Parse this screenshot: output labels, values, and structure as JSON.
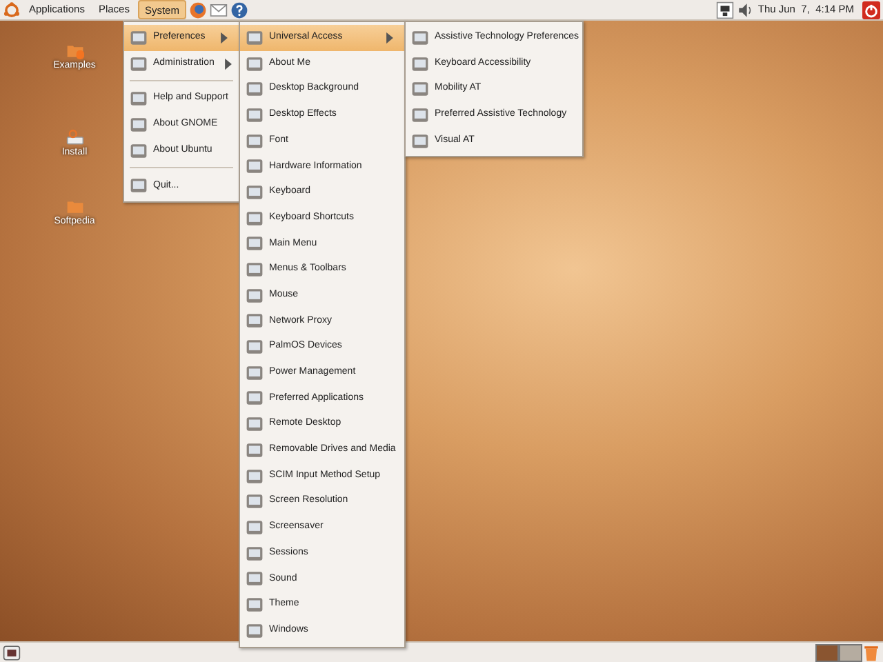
{
  "top_panel": {
    "menus": [
      {
        "label": "Applications",
        "selected": false
      },
      {
        "label": "Places",
        "selected": false
      },
      {
        "label": "System",
        "selected": true
      }
    ],
    "clock": "Thu Jun  7,  4:14 PM"
  },
  "desktop_icons": [
    {
      "label": "Examples"
    },
    {
      "label": "Install"
    },
    {
      "label": "Softpedia"
    }
  ],
  "system_menu": [
    {
      "kind": "item",
      "label": "Preferences",
      "submenu": true,
      "selected": true
    },
    {
      "kind": "item",
      "label": "Administration",
      "submenu": true,
      "selected": false
    },
    {
      "kind": "separator"
    },
    {
      "kind": "item",
      "label": "Help and Support",
      "submenu": false,
      "selected": false
    },
    {
      "kind": "item",
      "label": "About GNOME",
      "submenu": false,
      "selected": false
    },
    {
      "kind": "item",
      "label": "About Ubuntu",
      "submenu": false,
      "selected": false
    },
    {
      "kind": "separator"
    },
    {
      "kind": "item",
      "label": "Quit...",
      "submenu": false,
      "selected": false
    }
  ],
  "preferences_menu": [
    {
      "label": "Universal Access",
      "submenu": true,
      "selected": true
    },
    {
      "label": "About Me",
      "submenu": false,
      "selected": false
    },
    {
      "label": "Desktop Background",
      "submenu": false,
      "selected": false
    },
    {
      "label": "Desktop Effects",
      "submenu": false,
      "selected": false
    },
    {
      "label": "Font",
      "submenu": false,
      "selected": false
    },
    {
      "label": "Hardware Information",
      "submenu": false,
      "selected": false
    },
    {
      "label": "Keyboard",
      "submenu": false,
      "selected": false
    },
    {
      "label": "Keyboard Shortcuts",
      "submenu": false,
      "selected": false
    },
    {
      "label": "Main Menu",
      "submenu": false,
      "selected": false
    },
    {
      "label": "Menus & Toolbars",
      "submenu": false,
      "selected": false
    },
    {
      "label": "Mouse",
      "submenu": false,
      "selected": false
    },
    {
      "label": "Network Proxy",
      "submenu": false,
      "selected": false
    },
    {
      "label": "PalmOS Devices",
      "submenu": false,
      "selected": false
    },
    {
      "label": "Power Management",
      "submenu": false,
      "selected": false
    },
    {
      "label": "Preferred Applications",
      "submenu": false,
      "selected": false
    },
    {
      "label": "Remote Desktop",
      "submenu": false,
      "selected": false
    },
    {
      "label": "Removable Drives and Media",
      "submenu": false,
      "selected": false
    },
    {
      "label": "SCIM Input Method Setup",
      "submenu": false,
      "selected": false
    },
    {
      "label": "Screen Resolution",
      "submenu": false,
      "selected": false
    },
    {
      "label": "Screensaver",
      "submenu": false,
      "selected": false
    },
    {
      "label": "Sessions",
      "submenu": false,
      "selected": false
    },
    {
      "label": "Sound",
      "submenu": false,
      "selected": false
    },
    {
      "label": "Theme",
      "submenu": false,
      "selected": false
    },
    {
      "label": "Windows",
      "submenu": false,
      "selected": false
    }
  ],
  "universal_access_menu": [
    {
      "label": "Assistive Technology Preferences",
      "selected": false
    },
    {
      "label": "Keyboard Accessibility",
      "selected": false
    },
    {
      "label": "Mobility AT",
      "selected": false
    },
    {
      "label": "Preferred Assistive Technology",
      "selected": false
    },
    {
      "label": "Visual AT",
      "selected": false
    }
  ],
  "bottom_panel": {
    "workspaces": [
      {
        "selected": true
      },
      {
        "selected": false
      }
    ]
  }
}
